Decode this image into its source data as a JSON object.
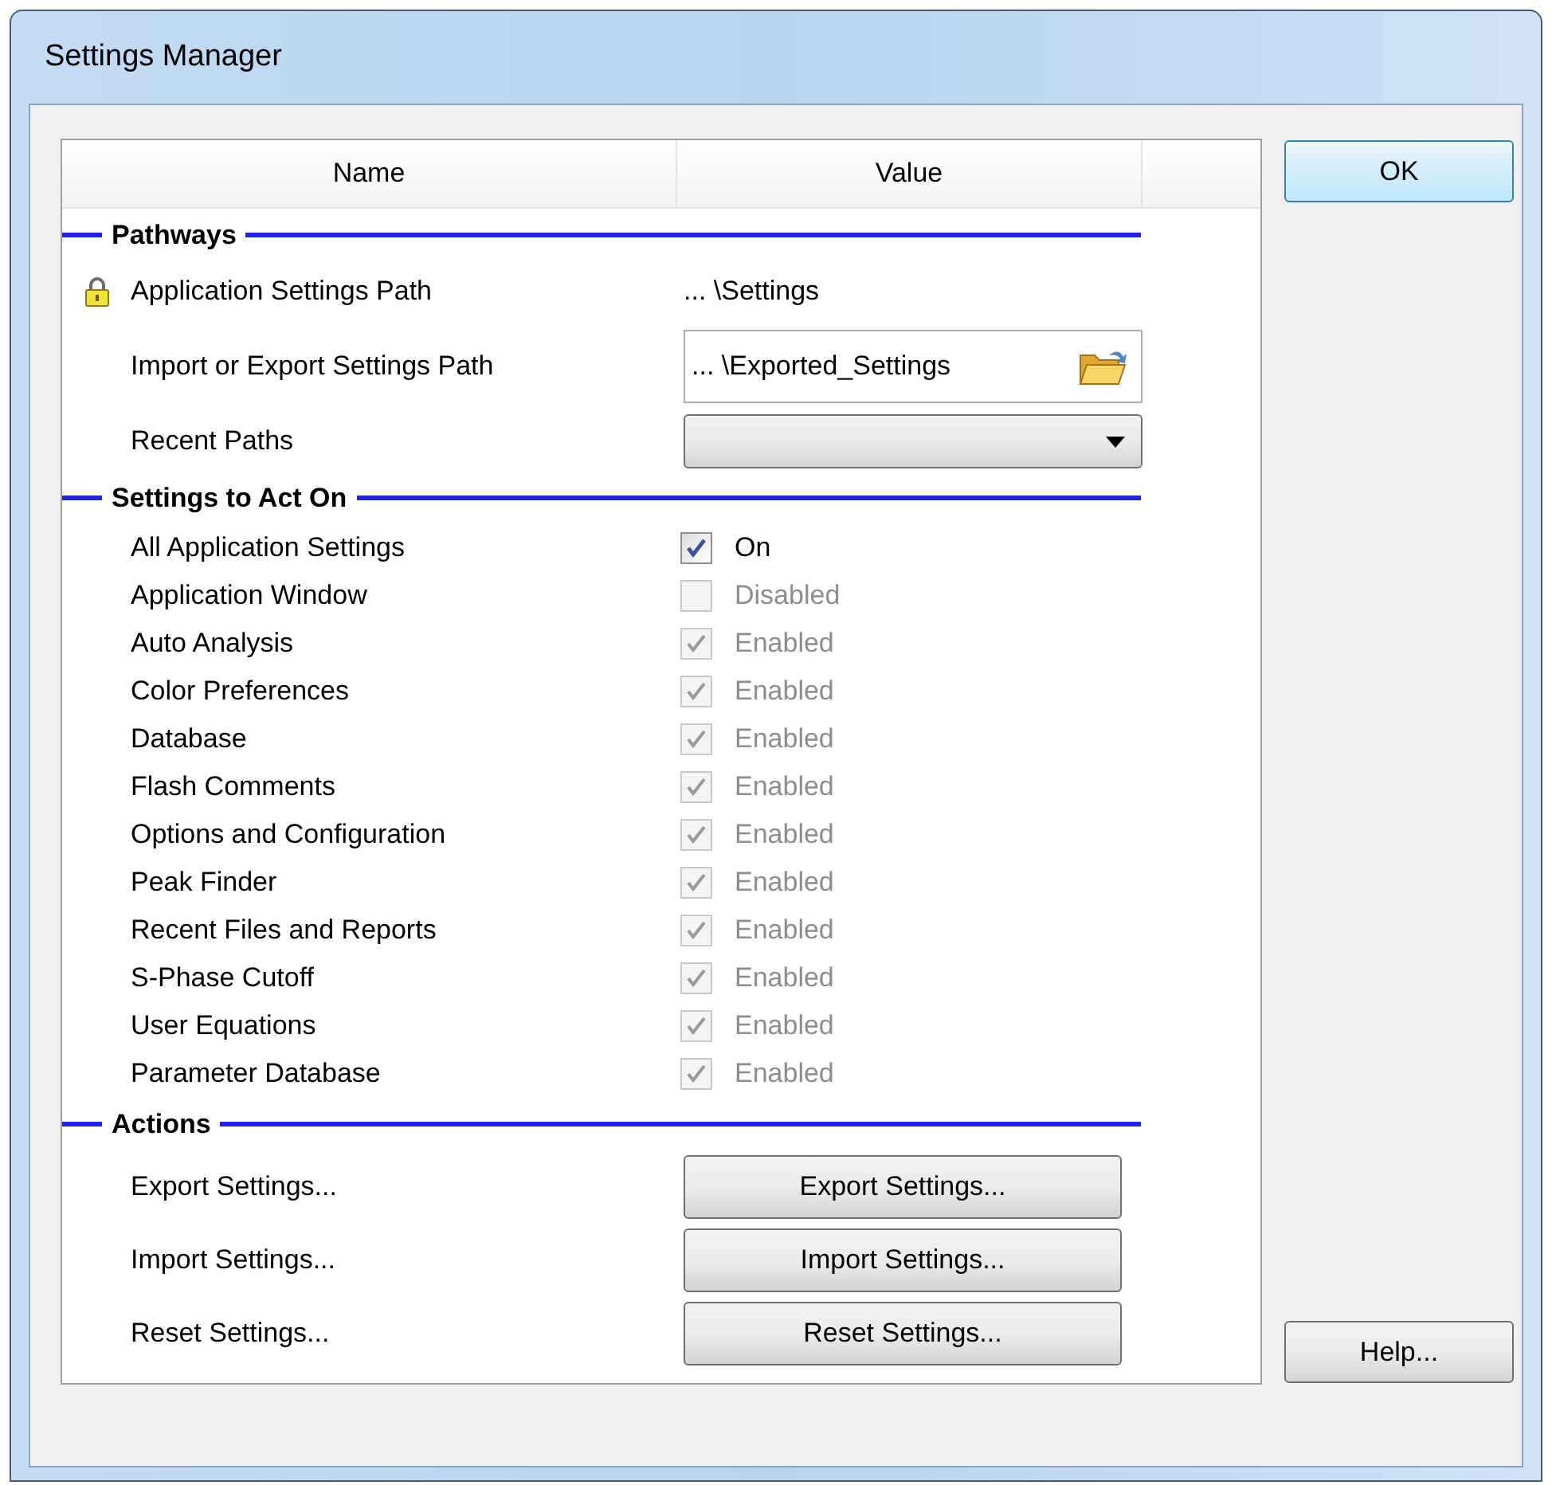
{
  "window": {
    "title": "Settings Manager"
  },
  "grid": {
    "columns": [
      "Name",
      "Value"
    ],
    "sections": [
      {
        "title": "Pathways",
        "rows": [
          {
            "kind": "text",
            "name": "Application Settings Path",
            "value": "... \\Settings",
            "locked": true
          },
          {
            "kind": "path",
            "name": "Import or Export Settings Path",
            "value": "... \\Exported_Settings"
          },
          {
            "kind": "dropdown",
            "name": "Recent Paths"
          }
        ]
      },
      {
        "title": "Settings to Act On",
        "rows": [
          {
            "kind": "checkbox",
            "name": "All Application Settings",
            "value": "On",
            "checked": true,
            "disabled": false
          },
          {
            "kind": "checkbox",
            "name": "Application Window",
            "value": "Disabled",
            "checked": false,
            "disabled": true
          },
          {
            "kind": "checkbox",
            "name": "Auto Analysis",
            "value": "Enabled",
            "checked": true,
            "disabled": true
          },
          {
            "kind": "checkbox",
            "name": "Color Preferences",
            "value": "Enabled",
            "checked": true,
            "disabled": true
          },
          {
            "kind": "checkbox",
            "name": "Database",
            "value": "Enabled",
            "checked": true,
            "disabled": true
          },
          {
            "kind": "checkbox",
            "name": "Flash Comments",
            "value": "Enabled",
            "checked": true,
            "disabled": true
          },
          {
            "kind": "checkbox",
            "name": "Options and Configuration",
            "value": "Enabled",
            "checked": true,
            "disabled": true
          },
          {
            "kind": "checkbox",
            "name": "Peak Finder",
            "value": "Enabled",
            "checked": true,
            "disabled": true
          },
          {
            "kind": "checkbox",
            "name": "Recent Files and Reports",
            "value": "Enabled",
            "checked": true,
            "disabled": true
          },
          {
            "kind": "checkbox",
            "name": "S-Phase Cutoff",
            "value": "Enabled",
            "checked": true,
            "disabled": true
          },
          {
            "kind": "checkbox",
            "name": "User Equations",
            "value": "Enabled",
            "checked": true,
            "disabled": true
          },
          {
            "kind": "checkbox",
            "name": "Parameter Database",
            "value": "Enabled",
            "checked": true,
            "disabled": true
          }
        ]
      },
      {
        "title": "Actions",
        "rows": [
          {
            "kind": "button",
            "name": "Export Settings...",
            "value": "Export Settings..."
          },
          {
            "kind": "button",
            "name": "Import Settings...",
            "value": "Import Settings..."
          },
          {
            "kind": "button",
            "name": "Reset Settings...",
            "value": "Reset Settings..."
          }
        ]
      }
    ]
  },
  "buttons": {
    "ok": "OK",
    "help": "Help..."
  }
}
